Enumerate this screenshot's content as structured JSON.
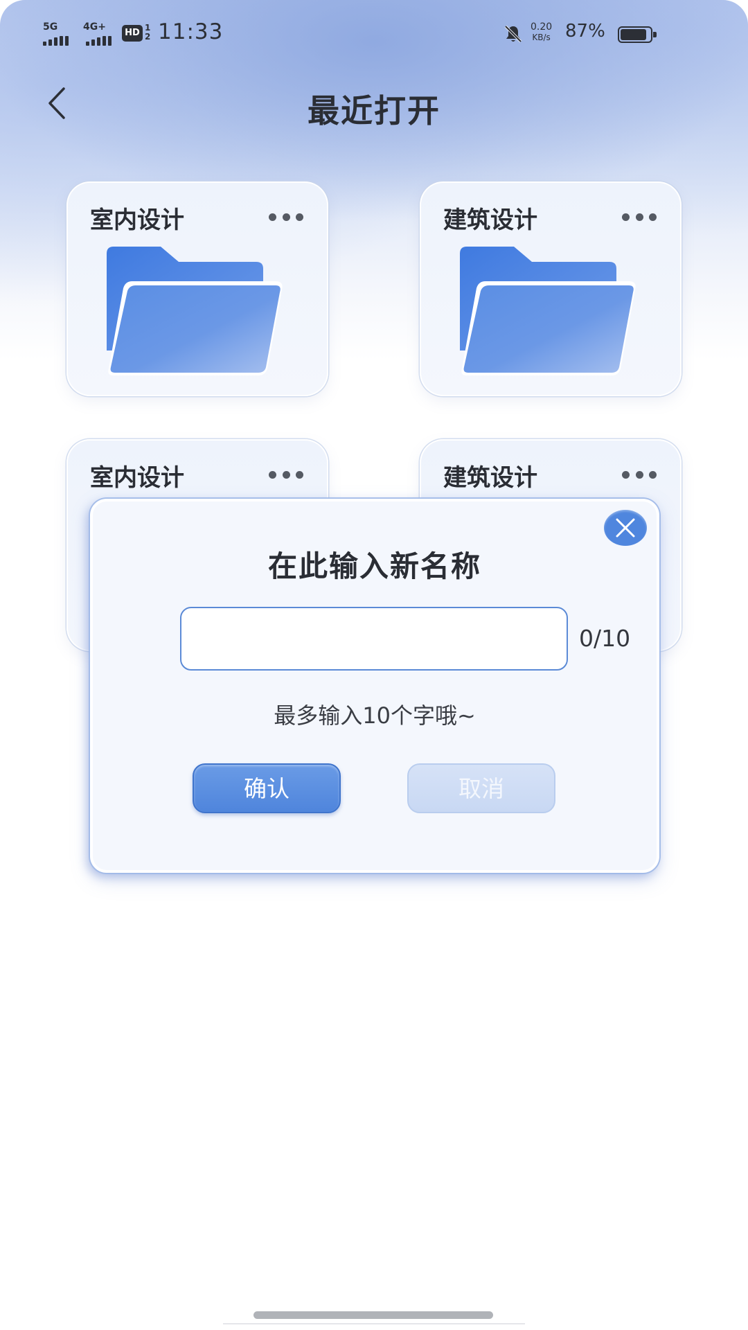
{
  "status_bar": {
    "network_1": "5G",
    "network_2": "4G+",
    "hd_label": "HD",
    "hd_sim": "1\n2",
    "time": "11:33",
    "speed_value": "0.20",
    "speed_unit": "KB/s",
    "battery_percent": "87%",
    "battery_level": 0.87,
    "icons": [
      "signal-5g-icon",
      "signal-4g-icon",
      "hd-voice-icon",
      "mute-bell-icon",
      "battery-icon"
    ]
  },
  "header": {
    "back_icon": "chevron-left-icon",
    "title": "最近打开"
  },
  "cards": [
    {
      "title": "室内设计",
      "icon": "folder-icon",
      "more_icon": "more-dots-icon"
    },
    {
      "title": "建筑设计",
      "icon": "folder-icon",
      "more_icon": "more-dots-icon"
    },
    {
      "title": "室内设计",
      "icon": "folder-icon",
      "more_icon": "more-dots-icon"
    },
    {
      "title": "建筑设计",
      "icon": "folder-icon",
      "more_icon": "more-dots-icon"
    }
  ],
  "rename_dialog": {
    "title": "在此输入新名称",
    "input_value": "",
    "input_placeholder": "",
    "counter": "0/10",
    "hint": "最多输入10个字哦~",
    "confirm_label": "确认",
    "cancel_label": "取消",
    "close_icon": "close-icon"
  },
  "colors": {
    "accent": "#4f86de",
    "title_text": "#2a2d34",
    "cancel_button": "#c8d8f3"
  }
}
